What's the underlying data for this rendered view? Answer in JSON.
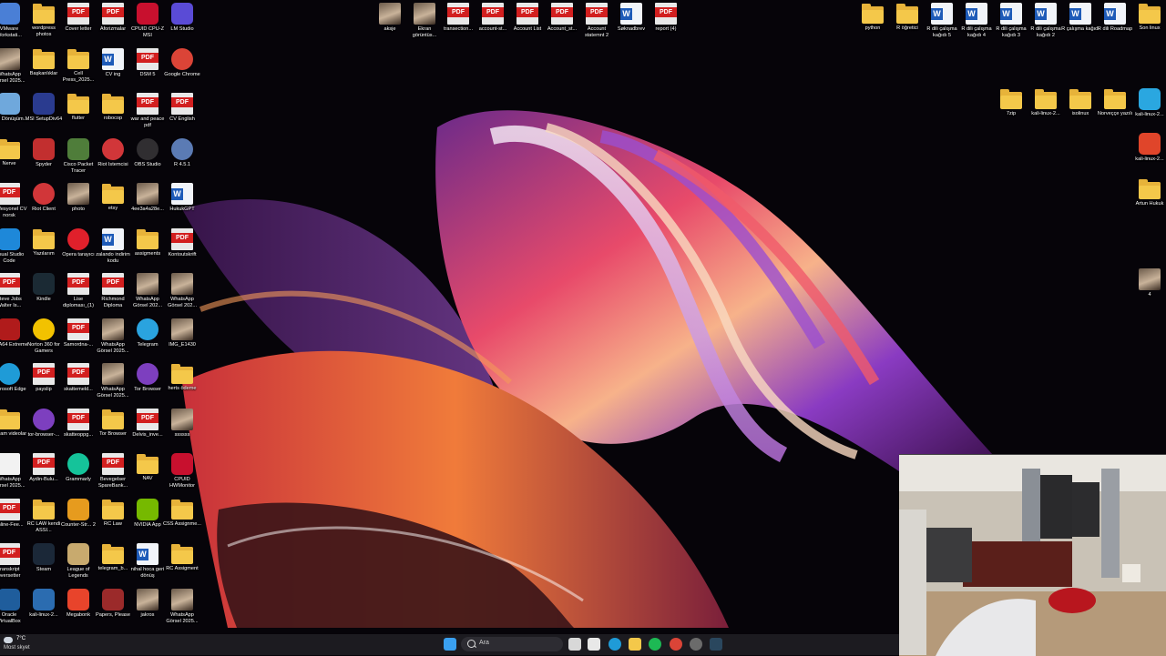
{
  "desktop": {
    "icons": [
      {
        "label": "VMware Workstati...",
        "type": "app",
        "color": "#4a7fd6"
      },
      {
        "label": "wordpress photos",
        "type": "folder"
      },
      {
        "label": "Cover letter",
        "type": "pdf"
      },
      {
        "label": "Aforizmalar",
        "type": "pdf"
      },
      {
        "label": "CPUID CPU-Z MSI",
        "type": "app",
        "color": "#c8102e"
      },
      {
        "label": "LM Studio",
        "type": "app",
        "color": "#5a4bd6"
      },
      {
        "label": "WhatsApp Görsel 2025...",
        "type": "photo"
      },
      {
        "label": "Başkanlıklar",
        "type": "folder"
      },
      {
        "label": "Cell Press_2025...",
        "type": "folder"
      },
      {
        "label": "CV ing",
        "type": "word"
      },
      {
        "label": "DSM 5",
        "type": "pdf"
      },
      {
        "label": "Google Chrome",
        "type": "round",
        "color": "#db4437"
      },
      {
        "label": "Geri Dönüşüm...",
        "type": "app",
        "color": "#6fa8dc"
      },
      {
        "label": "MSI SetupDiv64",
        "type": "app",
        "color": "#2a3b8f"
      },
      {
        "label": "flutter",
        "type": "folder"
      },
      {
        "label": "robocop",
        "type": "folder"
      },
      {
        "label": "war and peace pdf",
        "type": "pdf"
      },
      {
        "label": "CV English",
        "type": "pdf"
      },
      {
        "label": "Nerve",
        "type": "folder"
      },
      {
        "label": "Spyder",
        "type": "app",
        "color": "#c22f2f"
      },
      {
        "label": "Cisco Packet Tracer",
        "type": "app",
        "color": "#4f7d3a"
      },
      {
        "label": "Riot İstemcisi",
        "type": "round",
        "color": "#d13639"
      },
      {
        "label": "OBS Studio",
        "type": "round",
        "color": "#302e31"
      },
      {
        "label": "R 4.5.1",
        "type": "round",
        "color": "#5b7bb4"
      },
      {
        "label": "Profesyonel CV norsk",
        "type": "pdf"
      },
      {
        "label": "Riot Client",
        "type": "round",
        "color": "#d13639"
      },
      {
        "label": "photo",
        "type": "photo"
      },
      {
        "label": "etsy",
        "type": "folder"
      },
      {
        "label": "4ee3a4a28e...",
        "type": "photo"
      },
      {
        "label": "HukukGPT",
        "type": "word"
      },
      {
        "label": "Visual Studio Code",
        "type": "app",
        "color": "#1e88d9"
      },
      {
        "label": "Yazılarım",
        "type": "folder"
      },
      {
        "label": "Opera tarayıcı",
        "type": "round",
        "color": "#e0202b"
      },
      {
        "label": "zalando indirim kodu",
        "type": "word"
      },
      {
        "label": "assigments",
        "type": "folder"
      },
      {
        "label": "Kontoutskrift",
        "type": "pdf"
      },
      {
        "label": "Steve Jobs Walter Is...",
        "type": "pdf"
      },
      {
        "label": "Kindle",
        "type": "app",
        "color": "#1b2a34"
      },
      {
        "label": "Lise diploması_(1)",
        "type": "pdf"
      },
      {
        "label": "Richmond Diploma",
        "type": "pdf"
      },
      {
        "label": "WhatsApp Görsel 202...",
        "type": "photo"
      },
      {
        "label": "WhatsApp Görsel 202...",
        "type": "photo"
      },
      {
        "label": "AIDA64 Extreme",
        "type": "app",
        "color": "#b01b1b"
      },
      {
        "label": "Norton 360 for Gamers",
        "type": "round",
        "color": "#f2c200"
      },
      {
        "label": "Samordna-...",
        "type": "pdf"
      },
      {
        "label": "WhatsApp Görsel 2025...",
        "type": "photo"
      },
      {
        "label": "Telegram",
        "type": "round",
        "color": "#2aa3df"
      },
      {
        "label": "IMG_E1430",
        "type": "photo"
      },
      {
        "label": "Microsoft Edge",
        "type": "round",
        "color": "#1f9bd7"
      },
      {
        "label": "payslip",
        "type": "pdf"
      },
      {
        "label": "skattemeld...",
        "type": "pdf"
      },
      {
        "label": "WhatsApp Görsel 2025...",
        "type": "photo"
      },
      {
        "label": "Tor Browser",
        "type": "round",
        "color": "#7d3fbf"
      },
      {
        "label": "herts ödeme",
        "type": "folder"
      },
      {
        "label": "babam videolar",
        "type": "folder"
      },
      {
        "label": "tor-browser-...",
        "type": "round",
        "color": "#7d3fbf"
      },
      {
        "label": "skatteoppg...",
        "type": "pdf"
      },
      {
        "label": "Tor Browser",
        "type": "folder"
      },
      {
        "label": "Delvis_inve...",
        "type": "pdf"
      },
      {
        "label": "ssssss",
        "type": "photo"
      },
      {
        "label": "WhatsApp Görsel 2025...",
        "type": "doc"
      },
      {
        "label": "Aydin-Bulu...",
        "type": "pdf"
      },
      {
        "label": "Grammarly",
        "type": "round",
        "color": "#15c39a"
      },
      {
        "label": "Bevegelser SpareBank...",
        "type": "pdf"
      },
      {
        "label": "NAV",
        "type": "folder"
      },
      {
        "label": "CPUID HWMonitor",
        "type": "app",
        "color": "#c8102e"
      },
      {
        "label": "online-Fee...",
        "type": "pdf"
      },
      {
        "label": "RC LAW kendi ASSI...",
        "type": "folder"
      },
      {
        "label": "Counter-Str... 2",
        "type": "app",
        "color": "#e69b1e"
      },
      {
        "label": "RC Law",
        "type": "folder"
      },
      {
        "label": "NVIDIA App",
        "type": "app",
        "color": "#76b900"
      },
      {
        "label": "CSS Assignme...",
        "type": "folder"
      },
      {
        "label": "transkript oversetter",
        "type": "pdf"
      },
      {
        "label": "Steam",
        "type": "app",
        "color": "#1b2838"
      },
      {
        "label": "League of Legends",
        "type": "app",
        "color": "#c8aa6e"
      },
      {
        "label": "telegram_b...",
        "type": "folder"
      },
      {
        "label": "nihal hoca geri dönüş",
        "type": "word"
      },
      {
        "label": "RC Assigment",
        "type": "folder"
      },
      {
        "label": "Oracle VirtualBox",
        "type": "app",
        "color": "#1f5d9c"
      },
      {
        "label": "kali-linux-2...",
        "type": "app",
        "color": "#2b6cb0"
      },
      {
        "label": "Megabonk",
        "type": "app",
        "color": "#e8442b"
      },
      {
        "label": "Papers, Please",
        "type": "app",
        "color": "#9b2a2a"
      },
      {
        "label": "jakros",
        "type": "photo"
      },
      {
        "label": "WhatsApp Görsel 2025...",
        "type": "photo"
      },
      {
        "label": "aksje",
        "type": "photo"
      },
      {
        "label": "Ekran görüntüs...",
        "type": "photo"
      },
      {
        "label": "transection...",
        "type": "pdf"
      },
      {
        "label": "account-st...",
        "type": "pdf"
      },
      {
        "label": "Account List",
        "type": "pdf"
      },
      {
        "label": "Account_st...",
        "type": "pdf"
      },
      {
        "label": "Account statemnt 2",
        "type": "pdf"
      },
      {
        "label": "Søknadbrev",
        "type": "word"
      },
      {
        "label": "report (4)",
        "type": "pdf"
      },
      {
        "label": "python",
        "type": "folder"
      },
      {
        "label": "R öğretici",
        "type": "folder"
      },
      {
        "label": "R dili çalışma kağıdı 5",
        "type": "word"
      },
      {
        "label": "R dili çalışma kağıdı 4",
        "type": "word"
      },
      {
        "label": "R dili çalışma kağıdı 3",
        "type": "word"
      },
      {
        "label": "R dili çalışma kağıdı 2",
        "type": "word"
      },
      {
        "label": "R çalışma kağıdı",
        "type": "word"
      },
      {
        "label": "R dili Roadmap",
        "type": "word"
      },
      {
        "label": "Son linux",
        "type": "folder"
      },
      {
        "label": "7zip",
        "type": "folder"
      },
      {
        "label": "kali-linux-2...",
        "type": "folder"
      },
      {
        "label": "isolinux",
        "type": "folder"
      },
      {
        "label": "Norveççe yazılı",
        "type": "folder"
      },
      {
        "label": "kali-linux-2...",
        "type": "app",
        "color": "#2aa7e0"
      },
      {
        "label": "kali-linux-2...",
        "type": "app",
        "color": "#e0452a"
      },
      {
        "label": "Artun Hukuk",
        "type": "folder"
      },
      {
        "label": "4",
        "type": "photo"
      }
    ]
  },
  "taskbar": {
    "weather": {
      "temp": "7°C",
      "desc": "Most skyet"
    },
    "search_placeholder": "Ara",
    "pinned": [
      {
        "name": "windows-start",
        "color": "#3aa0f0"
      },
      {
        "name": "task-view",
        "color": "#d8d8d8"
      },
      {
        "name": "microsoft-store",
        "color": "#e8e8e8"
      },
      {
        "name": "edge",
        "color": "#1f9bd7"
      },
      {
        "name": "file-explorer",
        "color": "#f4c84a"
      },
      {
        "name": "spotify",
        "color": "#1db954"
      },
      {
        "name": "chrome",
        "color": "#db4437"
      },
      {
        "name": "obs",
        "color": "#6b6b6b"
      },
      {
        "name": "steam",
        "color": "#2a475e"
      }
    ]
  },
  "webcam": {
    "label": "webcam overlay"
  }
}
